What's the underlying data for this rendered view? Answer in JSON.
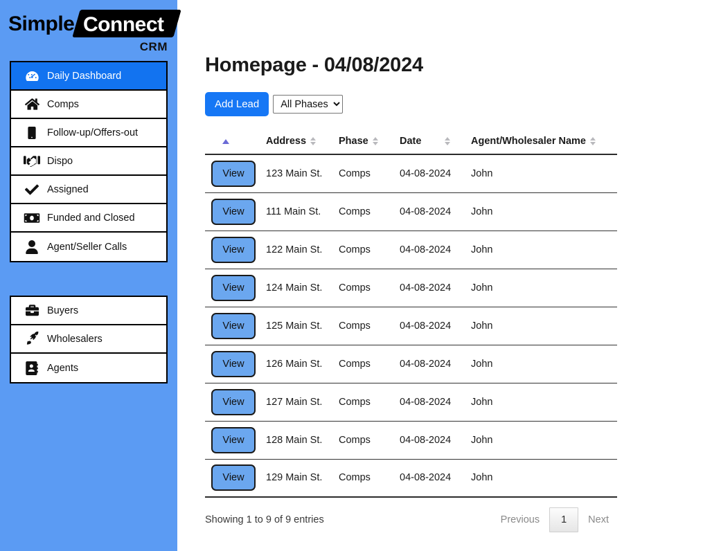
{
  "brand": {
    "name_part1": "Simple",
    "name_part2": "Connect",
    "subtitle": "CRM"
  },
  "colors": {
    "sidebar_bg": "#5b9bf3",
    "active_nav_bg": "#1273f0",
    "add_lead_bg": "#1677f5",
    "view_button_bg": "#6ba7ef",
    "sort_active": "#6a6ad6"
  },
  "sidebar": {
    "primary_items": [
      {
        "label": "Daily Dashboard",
        "icon": "gauge-icon",
        "active": true
      },
      {
        "label": "Comps",
        "icon": "home-icon",
        "active": false
      },
      {
        "label": "Follow-up/Offers-out",
        "icon": "mobile-phone-icon",
        "active": false
      },
      {
        "label": "Dispo",
        "icon": "handshake-icon",
        "active": false
      },
      {
        "label": "Assigned",
        "icon": "check-icon",
        "active": false
      },
      {
        "label": "Funded and Closed",
        "icon": "money-bill-icon",
        "active": false
      },
      {
        "label": "Agent/Seller Calls",
        "icon": "user-icon",
        "active": false
      }
    ],
    "secondary_items": [
      {
        "label": "Buyers",
        "icon": "briefcase-icon"
      },
      {
        "label": "Wholesalers",
        "icon": "rocket-icon"
      },
      {
        "label": "Agents",
        "icon": "address-book-icon"
      }
    ]
  },
  "main": {
    "page_title": "Homepage - 04/08/2024",
    "add_lead_label": "Add Lead",
    "phase_filter": {
      "selected": "All Phases",
      "options": [
        "All Phases"
      ]
    },
    "table": {
      "headers": {
        "view": "",
        "address": "Address",
        "phase": "Phase",
        "date": "Date",
        "agent": "Agent/Wholesaler Name"
      },
      "sort": {
        "column": "view",
        "direction": "asc"
      },
      "row_action_label": "View",
      "rows": [
        {
          "address": "123 Main St.",
          "phase": "Comps",
          "date": "04-08-2024",
          "agent": "John"
        },
        {
          "address": "111 Main St.",
          "phase": "Comps",
          "date": "04-08-2024",
          "agent": "John"
        },
        {
          "address": "122 Main St.",
          "phase": "Comps",
          "date": "04-08-2024",
          "agent": "John"
        },
        {
          "address": "124 Main St.",
          "phase": "Comps",
          "date": "04-08-2024",
          "agent": "John"
        },
        {
          "address": "125 Main St.",
          "phase": "Comps",
          "date": "04-08-2024",
          "agent": "John"
        },
        {
          "address": "126 Main St.",
          "phase": "Comps",
          "date": "04-08-2024",
          "agent": "John"
        },
        {
          "address": "127 Main St.",
          "phase": "Comps",
          "date": "04-08-2024",
          "agent": "John"
        },
        {
          "address": "128 Main St.",
          "phase": "Comps",
          "date": "04-08-2024",
          "agent": "John"
        },
        {
          "address": "129 Main St.",
          "phase": "Comps",
          "date": "04-08-2024",
          "agent": "John"
        }
      ]
    },
    "footer": {
      "entries_info": "Showing 1 to 9 of 9 entries",
      "previous_label": "Previous",
      "current_page": "1",
      "next_label": "Next"
    }
  }
}
